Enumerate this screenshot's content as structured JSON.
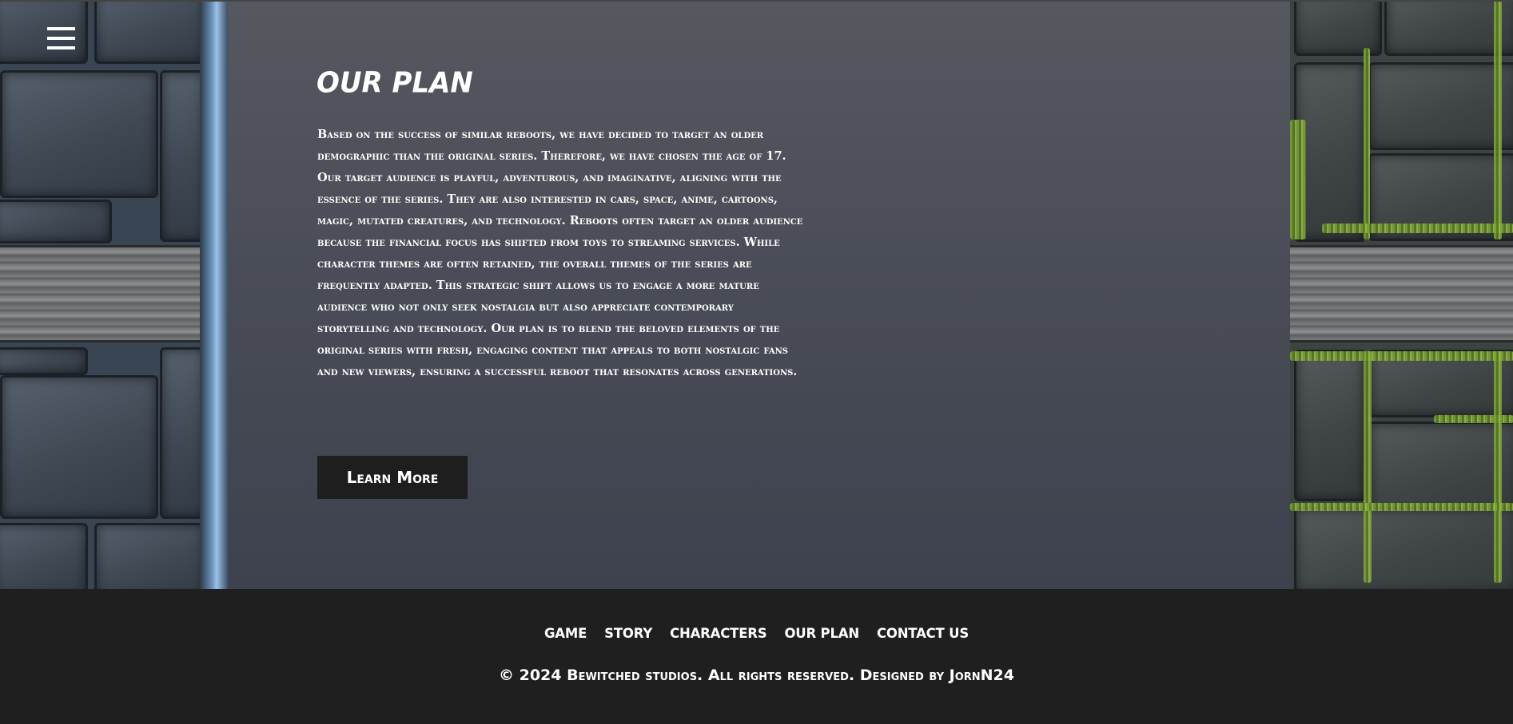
{
  "menu": {
    "icon": "hamburger-menu-icon"
  },
  "section": {
    "title": "OUR PLAN",
    "body": "Based on the success of similar reboots, we have decided to target an older demographic than the original series. Therefore, we have chosen the age of 17. Our target audience is playful, adventurous, and imaginative, aligning with the essence of the series. They are also interested in cars, space, anime, cartoons, magic, mutated creatures, and technology. Reboots often target an older audience because the financial focus has shifted from toys to streaming services. While character themes are often retained, the overall themes of the series are frequently adapted. This strategic shift allows us to engage a more mature audience who not only seek nostalgia but also appreciate contemporary storytelling and technology. Our plan is to blend the beloved elements of the original series with fresh, engaging content that appeals to both nostalgic fans and new viewers, ensuring a successful reboot that resonates across generations.",
    "button_label": "Learn More"
  },
  "footer": {
    "nav": [
      "GAME",
      "STORY",
      "CHARACTERS",
      "OUR PLAN",
      "CONTACT US"
    ],
    "copyright": "© 2024 Bewitched studios. All rights reserved. Designed by JornN24"
  },
  "colors": {
    "main_top": "#565860",
    "main_bottom": "#3e424e",
    "footer_bg": "#1f1f1f",
    "button_bg": "#1e1e1e",
    "text": "#ffffff"
  }
}
